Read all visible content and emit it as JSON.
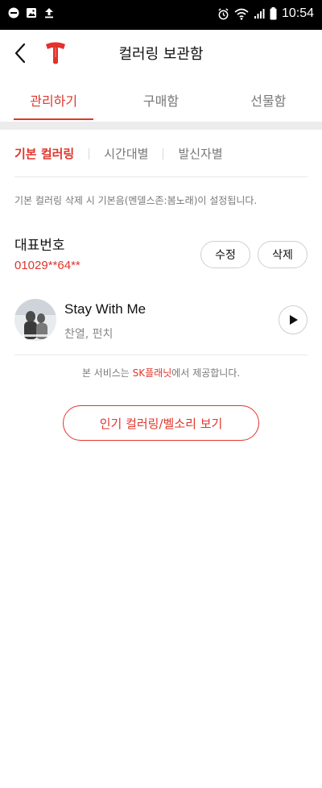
{
  "status_bar": {
    "time": "10:54",
    "left_icons": [
      "do-not-disturb-icon",
      "gallery-icon",
      "upload-icon"
    ],
    "right_icons": [
      "alarm-icon",
      "wifi-icon",
      "signal-icon",
      "battery-icon"
    ]
  },
  "header": {
    "title": "컬러링 보관함",
    "back_icon": "chevron-left-icon",
    "logo_icon": "t-logo-icon"
  },
  "tabs": [
    {
      "label": "관리하기",
      "active": true
    },
    {
      "label": "구매함",
      "active": false
    },
    {
      "label": "선물함",
      "active": false
    }
  ],
  "subtabs": [
    {
      "label": "기본 컬러링",
      "active": true
    },
    {
      "label": "시간대별",
      "active": false
    },
    {
      "label": "발신자별",
      "active": false
    }
  ],
  "notice": "기본 컬러링 삭제 시 기본음(멘델스존:봄노래)이 설정됩니다.",
  "representative": {
    "label": "대표번호",
    "number": "01029**64**",
    "edit_label": "수정",
    "delete_label": "삭제"
  },
  "song": {
    "title": "Stay With Me",
    "artist": "찬열, 펀치",
    "play_icon": "play-icon"
  },
  "provider": {
    "prefix": "본 서비스는 ",
    "brand": "SK플래닛",
    "suffix": "에서 제공합니다."
  },
  "popular_button": "인기 컬러링/벨소리 보기",
  "colors": {
    "accent": "#e0362c",
    "muted_text": "#777777",
    "divider": "#ececec"
  }
}
